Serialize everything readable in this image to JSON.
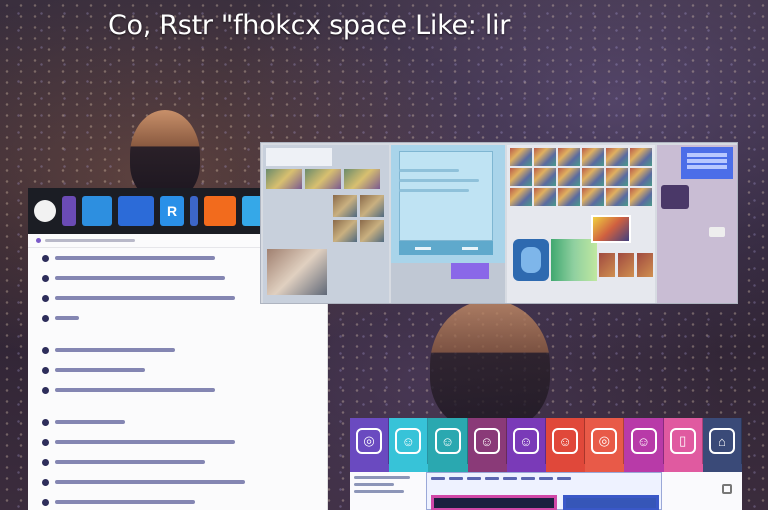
{
  "headline": "Co, Rstr \"fhokcx space Like: lir",
  "left_dock": {
    "apps": [
      {
        "icon": "round-app-icon"
      },
      {
        "icon": "purple-app-icon"
      },
      {
        "icon": "sky-app-icon"
      },
      {
        "icon": "blue-app-icon"
      },
      {
        "icon": "logo-app-icon",
        "glyph": "R"
      },
      {
        "icon": "stripe-app-icon"
      },
      {
        "icon": "orange-app-icon"
      },
      {
        "icon": "cyan-app-icon"
      },
      {
        "icon": "thumb-app-icon"
      }
    ]
  },
  "launcher": {
    "apps": [
      {
        "icon": "app-icon-1",
        "color": "#6a4ac0",
        "glyph": "◎"
      },
      {
        "icon": "app-icon-2",
        "color": "#37c3d8",
        "glyph": "☺"
      },
      {
        "icon": "app-icon-3",
        "color": "#2aa8b0",
        "glyph": "☺"
      },
      {
        "icon": "app-icon-4",
        "color": "#8a3a78",
        "glyph": "☺"
      },
      {
        "icon": "app-icon-5",
        "color": "#7a3ab8",
        "glyph": "☺"
      },
      {
        "icon": "app-icon-6",
        "color": "#e0483a",
        "glyph": "☺"
      },
      {
        "icon": "app-icon-7",
        "color": "#e85a48",
        "glyph": "◎"
      },
      {
        "icon": "app-icon-8",
        "color": "#b83aa8",
        "glyph": "☺"
      },
      {
        "icon": "app-icon-9",
        "color": "#e05aa0",
        "glyph": "▯"
      },
      {
        "icon": "app-icon-10",
        "color": "#3a4a78",
        "glyph": "⌂"
      }
    ]
  },
  "colors": {
    "accent_purple": "#7a5ac8",
    "card_pink": "#d048a8",
    "card_blue": "#3a58c8"
  }
}
